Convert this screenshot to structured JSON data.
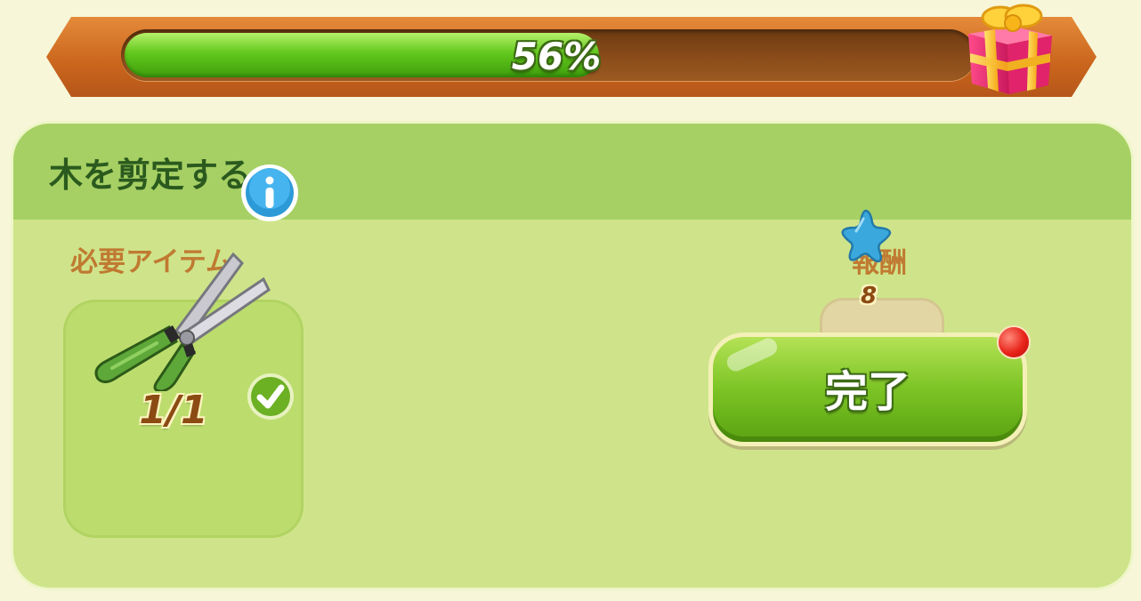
{
  "progress": {
    "percent_value": 56,
    "label": "56%",
    "reward_icon": "gift-box-icon"
  },
  "task": {
    "title": "木を剪定する",
    "required_items": {
      "label": "必要アイテム",
      "item_icon": "pruning-shears-icon",
      "count_text": "1/1",
      "info_icon": "info-icon",
      "status_icon": "check-icon"
    },
    "rewards": {
      "label": "報酬",
      "reward_icon": "blue-star-icon",
      "amount": "8"
    },
    "complete_button": {
      "label": "完了",
      "has_notification": true
    }
  },
  "colors": {
    "progress_fill": "#62c81c",
    "panel_background": "#cfe48a",
    "header_background": "#a6d064",
    "title_color": "#2b5a1e",
    "section_label_color": "#c07a32",
    "button_green": "#7cc424",
    "notification_red": "#e8231a"
  }
}
